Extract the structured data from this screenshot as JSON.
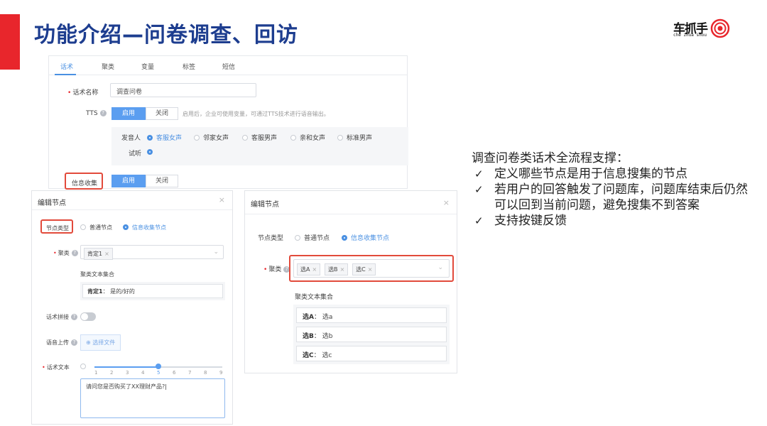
{
  "slide": {
    "title": "功能介绍—问卷调查、回访",
    "logo_main": "车抓手",
    "logo_sub": "che zhua shou"
  },
  "top_panel": {
    "tabs": [
      "话术",
      "聚类",
      "变量",
      "标签",
      "短信"
    ],
    "script_name_label": "话术名称",
    "script_name_value": "调查问卷",
    "tts_label": "TTS",
    "enable_label": "启用",
    "disable_label": "关闭",
    "tts_hint": "启用后，企业可使用变量，可通过TTS技术进行语音输出。",
    "speaker_label": "发音人",
    "voices": [
      "客服女声",
      "邻家女声",
      "客服男声",
      "亲和女声",
      "标准男声"
    ],
    "selected_voice": "客服女声",
    "listen_label": "试听",
    "info_collect_label": "信息收集"
  },
  "left_dialog": {
    "title": "编辑节点",
    "node_type_label": "节点类型",
    "node_types": [
      "普通节点",
      "信息收集节点"
    ],
    "cluster_label": "聚类",
    "cluster_tags": [
      "肯定1"
    ],
    "cluster_set_label": "聚类文本集合",
    "cluster_items": [
      {
        "name": "肯定1",
        "text": "是的/好的"
      }
    ],
    "splice_label": "话术拼接",
    "upload_label": "语音上传",
    "upload_button": "选择文件",
    "script_text_label": "话术文本",
    "slider_ticks": [
      "1",
      "2",
      "3",
      "4",
      "5",
      "6",
      "7",
      "8",
      "9"
    ],
    "slider_value": 5,
    "script_text_value": "请问您是否购买了XX理财产品?"
  },
  "right_dialog": {
    "title": "编辑节点",
    "node_type_label": "节点类型",
    "node_types": [
      "普通节点",
      "信息收集节点"
    ],
    "cluster_label": "聚类",
    "cluster_tags": [
      "选A",
      "选B",
      "选C"
    ],
    "cluster_set_label": "聚类文本集合",
    "cluster_items": [
      {
        "name": "选A",
        "text": "选a"
      },
      {
        "name": "选B",
        "text": "选b"
      },
      {
        "name": "选C",
        "text": "选c"
      }
    ]
  },
  "bullets": {
    "heading": "调查问卷类话术全流程支撑：",
    "items": [
      "定义哪些节点是用于信息搜集的节点",
      "若用户的回答触发了问题库，问题库结束后仍然可以回到当前问题，避免搜集不到答案",
      "支持按键反馈"
    ]
  },
  "colors": {
    "title_blue": "#1d3d8f",
    "accent_red": "#e8262c",
    "primary_blue": "#5b9ef0",
    "highlight_red": "#e24a3b"
  }
}
